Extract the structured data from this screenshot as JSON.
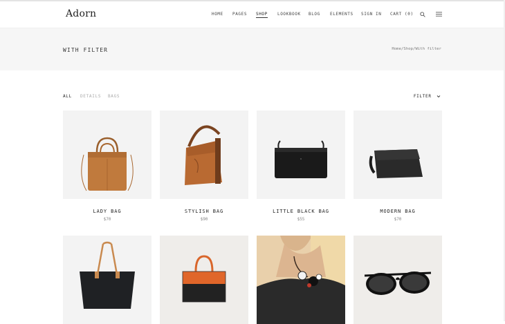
{
  "brand": {
    "logo": "Adorn"
  },
  "nav": {
    "items": [
      {
        "label": "HOME"
      },
      {
        "label": "PAGES"
      },
      {
        "label": "SHOP"
      },
      {
        "label": "LOOKBOOK"
      },
      {
        "label": "BLOG"
      },
      {
        "label": "ELEMENTS"
      },
      {
        "label": "SIGN IN"
      },
      {
        "label": "CART (0)"
      }
    ],
    "active": "SHOP",
    "icons": [
      "search-icon",
      "menu-icon"
    ]
  },
  "page": {
    "title": "WITH FILTER",
    "breadcrumb": "Home/Shop/With filter"
  },
  "filters": {
    "tabs": [
      {
        "label": "ALL"
      },
      {
        "label": "DETAILS"
      },
      {
        "label": "BAGS"
      }
    ],
    "active": "ALL",
    "dropdown_label": "FILTER"
  },
  "products": [
    {
      "name": "LADY BAG",
      "price": "$70",
      "image": "tan tote handbag"
    },
    {
      "name": "STYLISH BAG",
      "price": "$90",
      "image": "brown hobo bag"
    },
    {
      "name": "LITTLE BLACK BAG",
      "price": "$55",
      "image": "black crossbody bag"
    },
    {
      "name": "MODERN BAG",
      "price": "$70",
      "image": "black clutch bag"
    },
    {
      "name": "",
      "price": "",
      "image": "black tote with tan handles"
    },
    {
      "name": "",
      "price": "",
      "image": "orange and black satchel"
    },
    {
      "name": "",
      "price": "",
      "image": "woman wearing necklace"
    },
    {
      "name": "",
      "price": "",
      "image": "black sunglasses"
    }
  ],
  "colors": {
    "title_bg": "#f6f6f6",
    "product_bg": "#f3f3f3",
    "text": "#222222",
    "muted": "#aaaaaa"
  }
}
